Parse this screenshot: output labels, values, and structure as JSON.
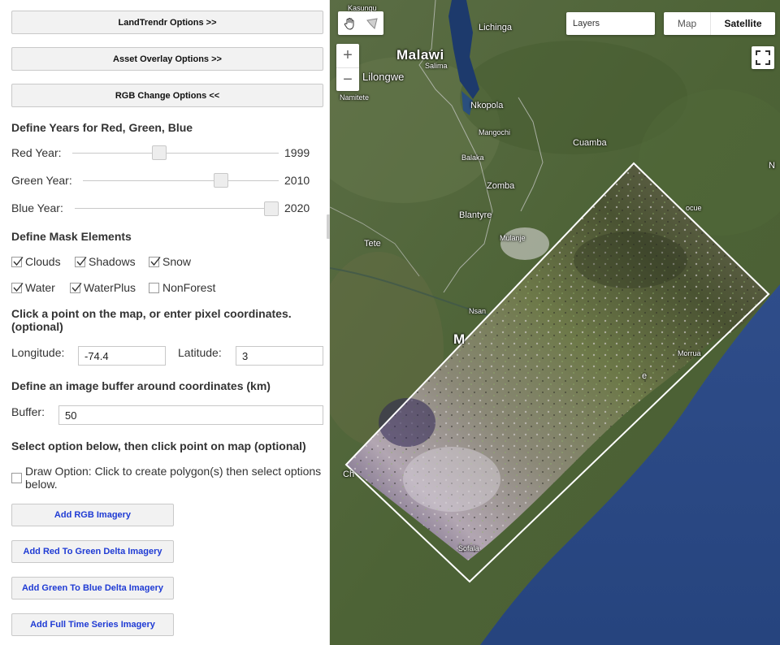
{
  "panel": {
    "buttons": {
      "landtrendr": "LandTrendr Options >>",
      "asset_overlay": "Asset Overlay Options >>",
      "rgb_change": "RGB Change Options <<"
    },
    "years_section": {
      "title": "Define Years for Red, Green, Blue",
      "red": {
        "label": "Red Year:",
        "value": "1999",
        "fraction": 0.42
      },
      "green": {
        "label": "Green Year:",
        "value": "2010",
        "fraction": 0.71
      },
      "blue": {
        "label": "Blue Year:",
        "value": "2020",
        "fraction": 1.0
      }
    },
    "mask_section": {
      "title": "Define Mask Elements",
      "items": [
        {
          "label": "Clouds",
          "checked": true
        },
        {
          "label": "Shadows",
          "checked": true
        },
        {
          "label": "Snow",
          "checked": true
        },
        {
          "label": "Water",
          "checked": true
        },
        {
          "label": "WaterPlus",
          "checked": true
        },
        {
          "label": "NonForest",
          "checked": false
        }
      ]
    },
    "coords_section": {
      "title": "Click a point on the map, or enter pixel coordinates. (optional)",
      "longitude_label": "Longitude:",
      "longitude_value": "-74.4",
      "latitude_label": "Latitude:",
      "latitude_value": "3"
    },
    "buffer_section": {
      "title": "Define an image buffer around coordinates (km)",
      "label": "Buffer:",
      "value": "50"
    },
    "option_section": {
      "title": "Select option below, then click point on map (optional)",
      "draw_option": "Draw Option: Click to create polygon(s) then select options below.",
      "draw_checked": false
    },
    "actions": {
      "add_rgb": "Add RGB Imagery",
      "add_red_green": "Add Red To Green Delta Imagery",
      "add_green_blue": "Add Green To Blue Delta Imagery",
      "add_full": "Add Full Time Series Imagery"
    }
  },
  "map": {
    "layers_label": "Layers",
    "map_type": {
      "map": "Map",
      "satellite": "Satellite",
      "selected": "Satellite"
    },
    "zoom_in": "+",
    "zoom_out": "−",
    "labels": {
      "kasungu": "Kasungu",
      "lichinga": "Lichinga",
      "malawi": "Malawi",
      "salima": "Salima",
      "lilongwe": "Lilongwe",
      "namitete": "Namitete",
      "nkopola": "Nkopola",
      "mangochi": "Mangochi",
      "cuamba": "Cuamba",
      "balaka": "Balaka",
      "zomba": "Zomba",
      "blantyre": "Blantyre",
      "mulanje": "Mulanje",
      "tete": "Tete",
      "nsan": "Nsan",
      "mocue": "ocue",
      "morrua": "Morrua",
      "m_partial": "M",
      "n_partial": "N",
      "ch_partial": "Ch",
      "sofala": "Sofala",
      "e_partial": "e"
    },
    "icons": {
      "pan": "hand-icon",
      "draw": "polygon-draw-icon",
      "fullscreen": "fullscreen-icon"
    }
  }
}
